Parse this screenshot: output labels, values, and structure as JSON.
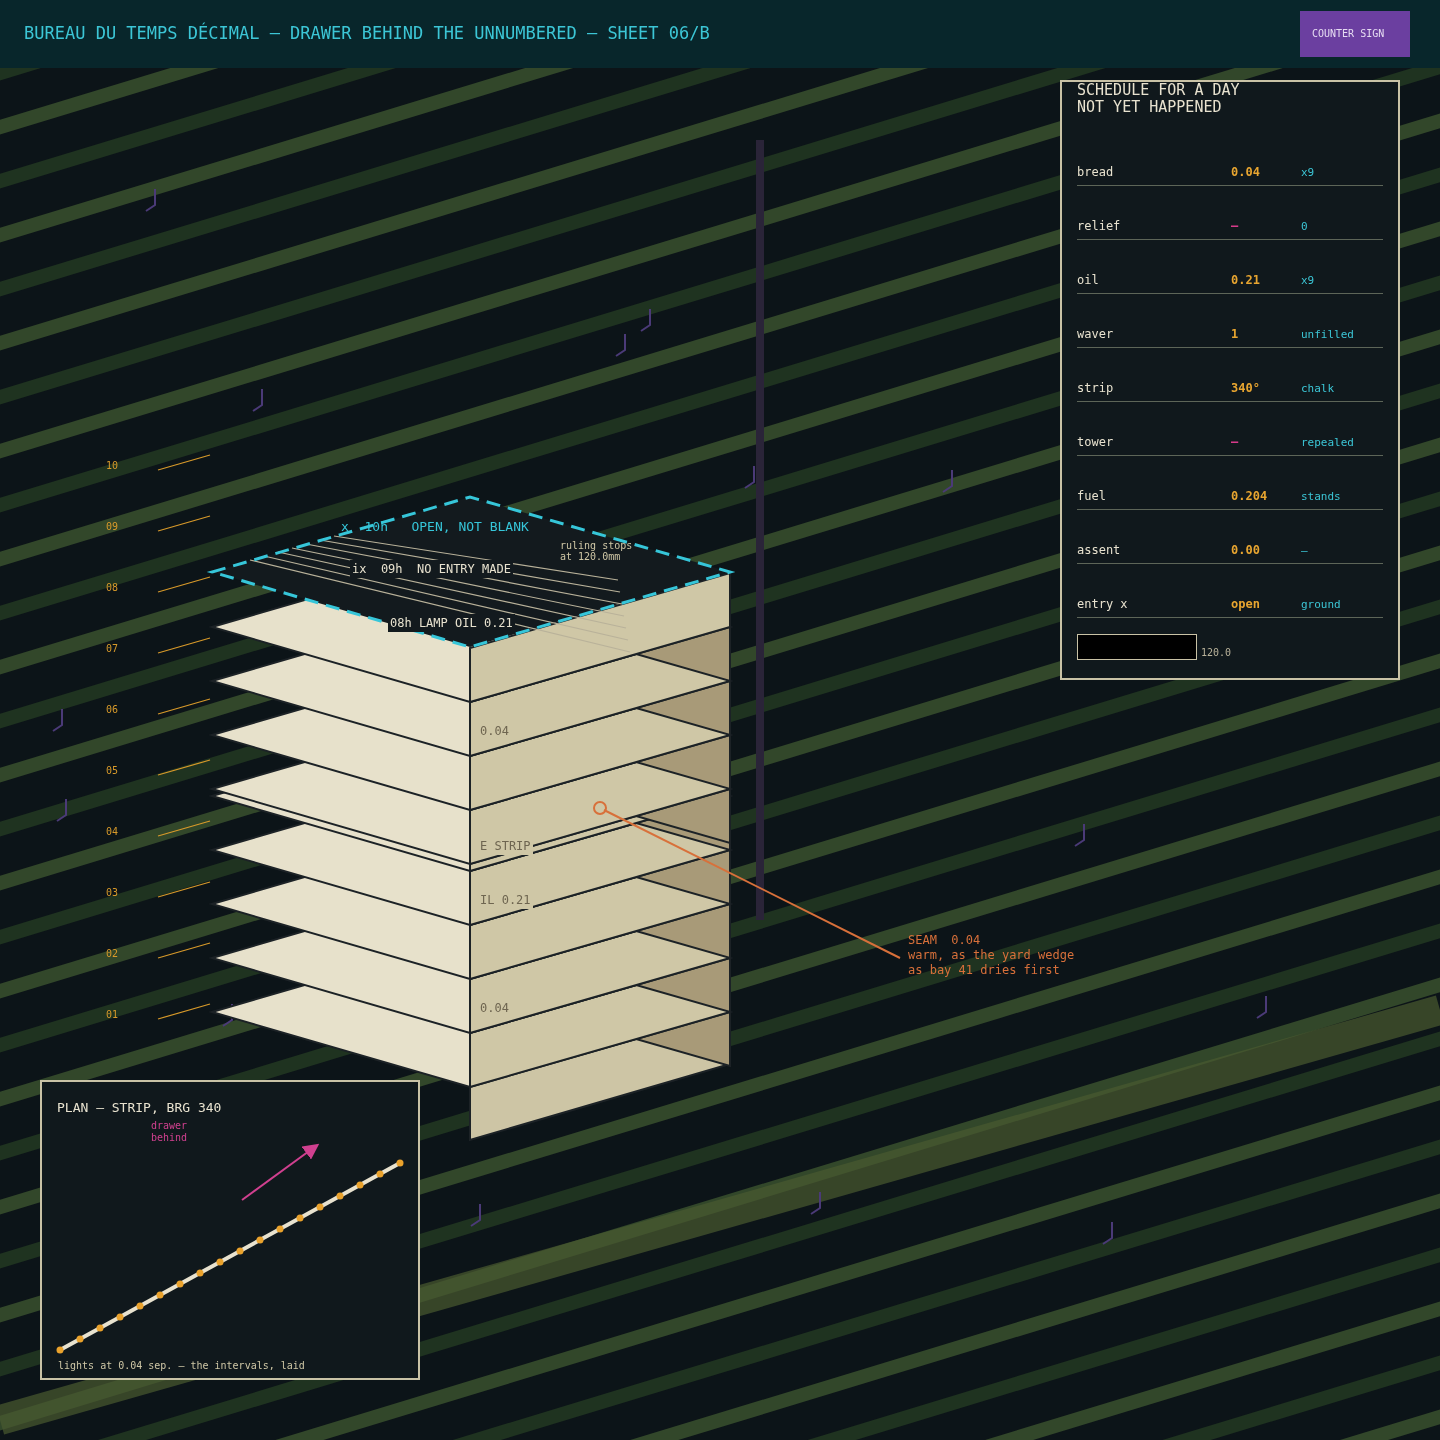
{
  "header": {
    "title": "BUREAU DU TEMPS DÉCIMAL — DRAWER BEHIND THE UNNUMBERED — SHEET 06/B",
    "badge": "COUNTER SIGN"
  },
  "scale": [
    "10",
    "09",
    "08",
    "07",
    "06",
    "05",
    "04",
    "03",
    "02",
    "01"
  ],
  "stack": {
    "top_label": "x  10h   OPEN, NOT BLANK",
    "note": [
      "ruling stops",
      "at 120.0mm"
    ],
    "entries": [
      "ix  09h  NO ENTRY MADE",
      "08h LAMP OIL 0.21",
      "0.04",
      "E STRIP",
      "IL 0.21",
      "0.04"
    ]
  },
  "seam": {
    "lines": [
      "SEAM  0.04",
      "warm, as the yard wedge",
      "as bay 41 dries first"
    ]
  },
  "schedule": {
    "title": [
      "SCHEDULE FOR A DAY",
      "NOT YET HAPPENED"
    ],
    "rows": [
      {
        "name": "bread",
        "value": "0.04",
        "color": "#e8a530",
        "note": "x9"
      },
      {
        "name": "relief",
        "value": "—",
        "color": "#d63a8a",
        "note": "0"
      },
      {
        "name": "oil",
        "value": "0.21",
        "color": "#e8a530",
        "note": "x9"
      },
      {
        "name": "waver",
        "value": "1",
        "color": "#e8a530",
        "note": "unfilled"
      },
      {
        "name": "strip",
        "value": "340°",
        "color": "#e8a530",
        "note": "chalk"
      },
      {
        "name": "tower",
        "value": "—",
        "color": "#d63a8a",
        "note": "repealed"
      },
      {
        "name": "fuel",
        "value": "0.204",
        "color": "#e8a530",
        "note": "stands"
      },
      {
        "name": "assent",
        "value": "0.00",
        "color": "#e8a530",
        "note": "—"
      },
      {
        "name": "entry x",
        "value": "open",
        "color": "#e8a530",
        "note": "ground"
      }
    ],
    "scale_reading": "120.0"
  },
  "plan": {
    "title": "PLAN — STRIP, BRG 340",
    "arrow_label": [
      "drawer",
      "behind"
    ],
    "caption": "lights at 0.04 sep. — the intervals, laid"
  }
}
